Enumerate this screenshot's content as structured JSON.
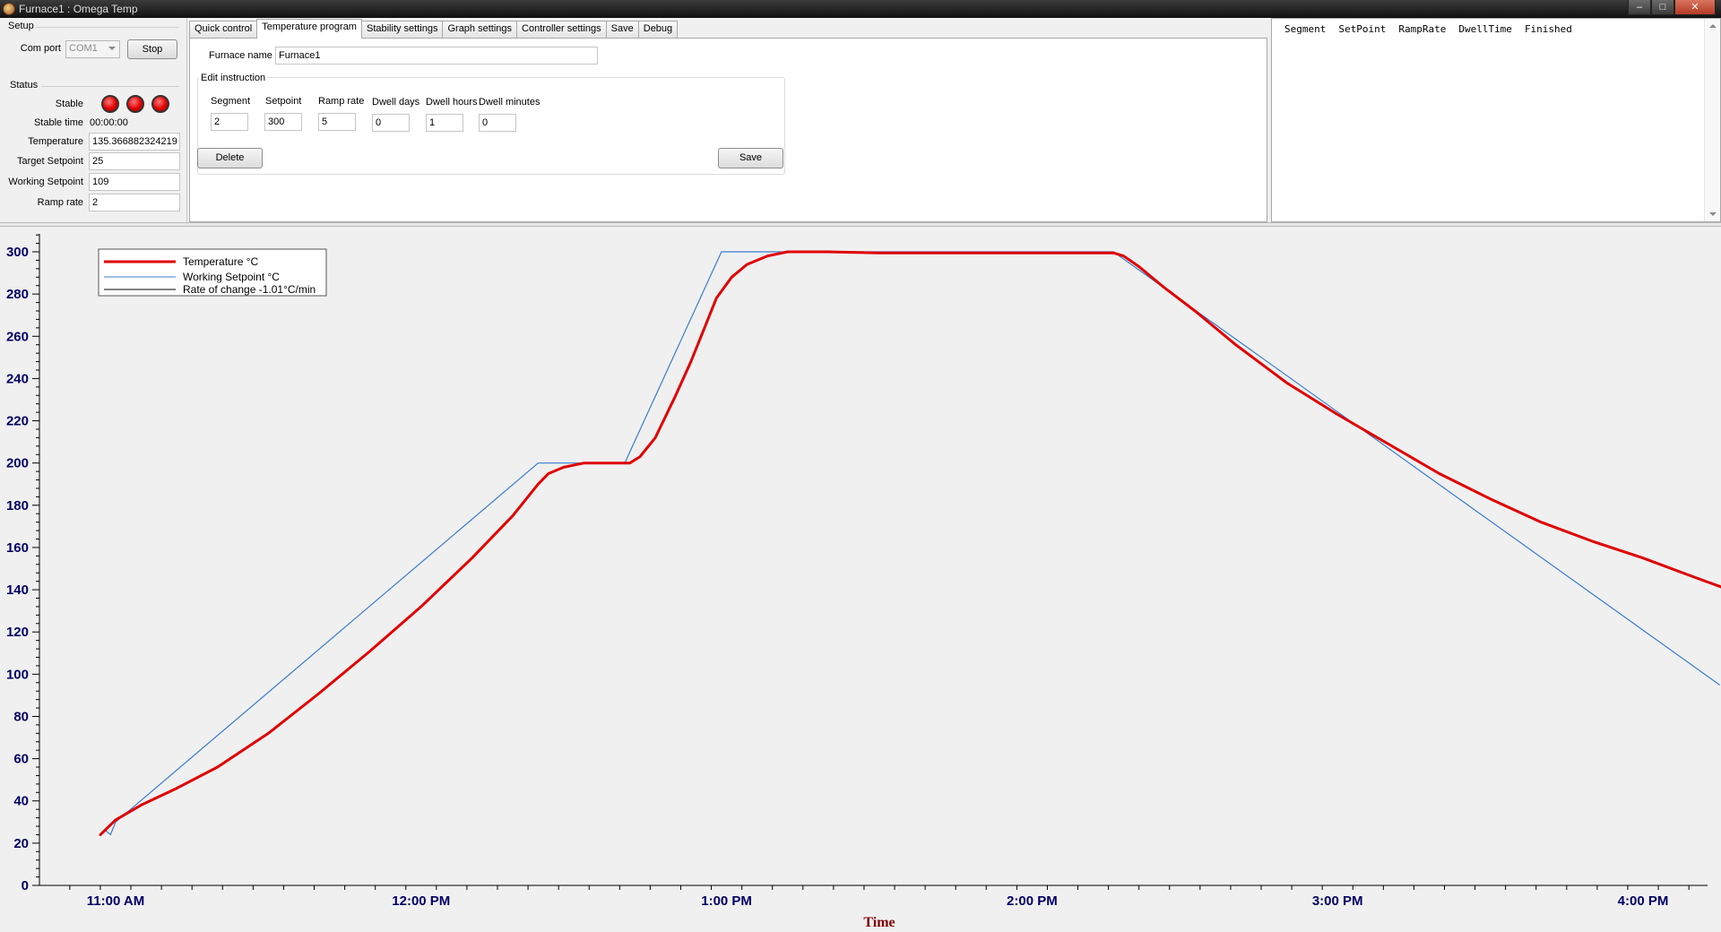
{
  "window": {
    "title": "Furnace1 : Omega Temp",
    "buttons": [
      "–",
      "□",
      "✕"
    ]
  },
  "setup": {
    "group_label": "Setup",
    "com_port_label": "Com port",
    "com_port_value": "COM1",
    "stop_label": "Stop"
  },
  "status": {
    "group_label": "Status",
    "stable_label": "Stable",
    "stable_time_label": "Stable time",
    "stable_time_value": "00:00:00",
    "temperature_label": "Temperature",
    "temperature_value": "135.366882324219",
    "target_setpoint_label": "Target Setpoint",
    "target_setpoint_value": "25",
    "working_setpoint_label": "Working Setpoint",
    "working_setpoint_value": "109",
    "ramp_rate_label": "Ramp rate",
    "ramp_rate_value": "2"
  },
  "tabs": [
    {
      "label": "Quick control"
    },
    {
      "label": "Temperature program"
    },
    {
      "label": "Stability settings"
    },
    {
      "label": "Graph settings"
    },
    {
      "label": "Controller settings"
    },
    {
      "label": "Save"
    },
    {
      "label": "Debug"
    }
  ],
  "program": {
    "furnace_name_label": "Furnace name",
    "furnace_name_value": "Furnace1",
    "edit_instruction_label": "Edit instruction",
    "segment_label": "Segment",
    "segment_value": "2",
    "setpoint_label": "Setpoint",
    "setpoint_value": "300",
    "ramp_rate_label": "Ramp rate",
    "ramp_rate_value": "5",
    "dwell_days_label": "Dwell days",
    "dwell_days_value": "0",
    "dwell_hours_label": "Dwell hours",
    "dwell_hours_value": "1",
    "dwell_minutes_label": "Dwell minutes",
    "dwell_minutes_value": "0",
    "delete_label": "Delete",
    "save_label": "Save"
  },
  "segment_table": {
    "columns": [
      "Segment",
      "SetPoint",
      "RampRate",
      "DwellTime",
      "Finished"
    ]
  },
  "chart_data": {
    "type": "line",
    "xlabel": "Time",
    "ylabel": "",
    "ylim": [
      0,
      310
    ],
    "yticks": [
      0,
      20,
      40,
      60,
      80,
      100,
      120,
      140,
      160,
      180,
      200,
      220,
      240,
      260,
      280,
      300
    ],
    "xlim_minutes": [
      645,
      1000
    ],
    "xticks": [
      {
        "label": "11:00 AM",
        "minutes": 660
      },
      {
        "label": "12:00 PM",
        "minutes": 720
      },
      {
        "label": "1:00 PM",
        "minutes": 780
      },
      {
        "label": "2:00 PM",
        "minutes": 840
      },
      {
        "label": "3:00 PM",
        "minutes": 900
      },
      {
        "label": "4:00 PM",
        "minutes": 960
      }
    ],
    "legend_position": "top-left",
    "series": [
      {
        "name": "Temperature °C",
        "color": "#e00000",
        "points": [
          [
            657,
            24
          ],
          [
            660,
            31
          ],
          [
            665,
            38
          ],
          [
            672,
            46
          ],
          [
            680,
            56
          ],
          [
            690,
            72
          ],
          [
            700,
            91
          ],
          [
            710,
            111
          ],
          [
            720,
            132
          ],
          [
            730,
            155
          ],
          [
            738,
            175
          ],
          [
            743,
            190
          ],
          [
            745,
            195
          ],
          [
            748,
            198
          ],
          [
            752,
            200
          ],
          [
            757,
            200
          ],
          [
            761,
            200
          ],
          [
            763,
            203
          ],
          [
            766,
            212
          ],
          [
            770,
            232
          ],
          [
            773,
            248
          ],
          [
            776,
            266
          ],
          [
            778,
            278
          ],
          [
            781,
            288
          ],
          [
            784,
            294
          ],
          [
            788,
            298
          ],
          [
            792,
            300
          ],
          [
            800,
            300
          ],
          [
            810,
            299.5
          ],
          [
            820,
            299.5
          ],
          [
            830,
            299.5
          ],
          [
            840,
            299.5
          ],
          [
            850,
            299.5
          ],
          [
            856,
            299.5
          ],
          [
            858,
            298
          ],
          [
            861,
            293
          ],
          [
            866,
            283
          ],
          [
            872,
            272
          ],
          [
            880,
            256
          ],
          [
            890,
            238
          ],
          [
            900,
            223
          ],
          [
            910,
            209
          ],
          [
            920,
            195
          ],
          [
            930,
            183
          ],
          [
            940,
            172
          ],
          [
            950,
            163
          ],
          [
            960,
            155
          ],
          [
            970,
            146
          ],
          [
            978,
            139
          ]
        ]
      },
      {
        "name": "Working Setpoint °C",
        "color": "#3a7ccc",
        "points": [
          [
            657,
            24
          ],
          [
            658,
            26
          ],
          [
            659,
            24
          ],
          [
            660,
            30
          ],
          [
            743,
            200
          ],
          [
            760,
            200
          ],
          [
            779,
            300
          ],
          [
            856,
            300
          ],
          [
            975,
            95
          ]
        ]
      },
      {
        "name": "Rate of change -1.01°C/min",
        "color": "#000000",
        "points": []
      }
    ]
  }
}
